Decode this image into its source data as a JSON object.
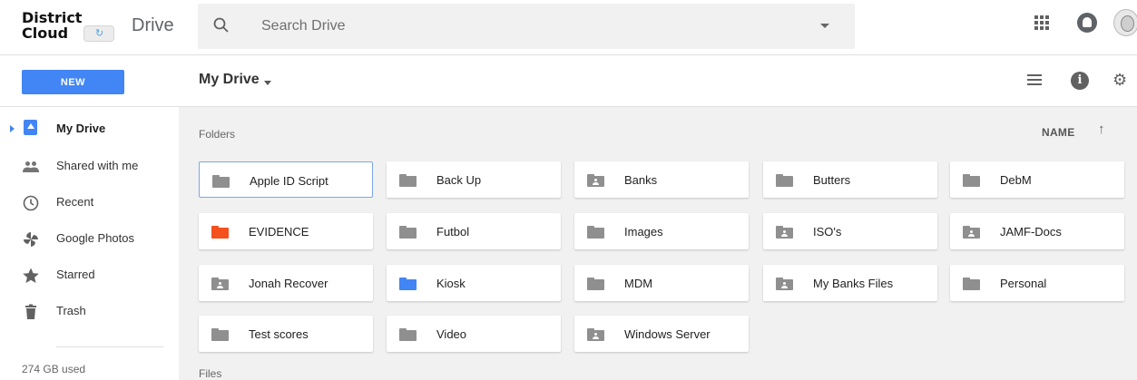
{
  "header": {
    "logo_line1": "District",
    "logo_line2": "Cloud",
    "product": "Drive",
    "search_placeholder": "Search Drive"
  },
  "toolbar": {
    "new_label": "NEW",
    "location_title": "My Drive"
  },
  "sidebar": {
    "items": [
      {
        "label": "My Drive",
        "icon": "drive-icon",
        "active": true
      },
      {
        "label": "Shared with me",
        "icon": "people-icon"
      },
      {
        "label": "Recent",
        "icon": "clock-icon"
      },
      {
        "label": "Google Photos",
        "icon": "pinwheel-icon"
      },
      {
        "label": "Starred",
        "icon": "star-icon"
      },
      {
        "label": "Trash",
        "icon": "trash-icon"
      }
    ],
    "storage": "274 GB used"
  },
  "main": {
    "folders_label": "Folders",
    "files_label": "Files",
    "sort_label": "NAME",
    "folders": [
      {
        "name": "Apple ID Script",
        "type": "folder",
        "selected": true
      },
      {
        "name": "Back Up",
        "type": "folder"
      },
      {
        "name": "Banks",
        "type": "shared-folder"
      },
      {
        "name": "Butters",
        "type": "folder"
      },
      {
        "name": "DebM",
        "type": "folder"
      },
      {
        "name": "EVIDENCE",
        "type": "folder",
        "color": "#f4511e"
      },
      {
        "name": "Futbol",
        "type": "folder"
      },
      {
        "name": "Images",
        "type": "folder"
      },
      {
        "name": "ISO's",
        "type": "shared-folder"
      },
      {
        "name": "JAMF-Docs",
        "type": "shared-folder"
      },
      {
        "name": "Jonah Recover",
        "type": "shared-folder"
      },
      {
        "name": "Kiosk",
        "type": "folder",
        "color": "#4285f4"
      },
      {
        "name": "MDM",
        "type": "folder"
      },
      {
        "name": "My Banks Files",
        "type": "shared-folder"
      },
      {
        "name": "Personal",
        "type": "folder"
      },
      {
        "name": "Test scores",
        "type": "folder"
      },
      {
        "name": "Video",
        "type": "folder"
      },
      {
        "name": "Windows Server",
        "type": "shared-folder"
      }
    ]
  },
  "colors": {
    "accent": "#4285f4",
    "folder_default": "#8f8f8f",
    "main_bg": "#f1f1f1"
  }
}
